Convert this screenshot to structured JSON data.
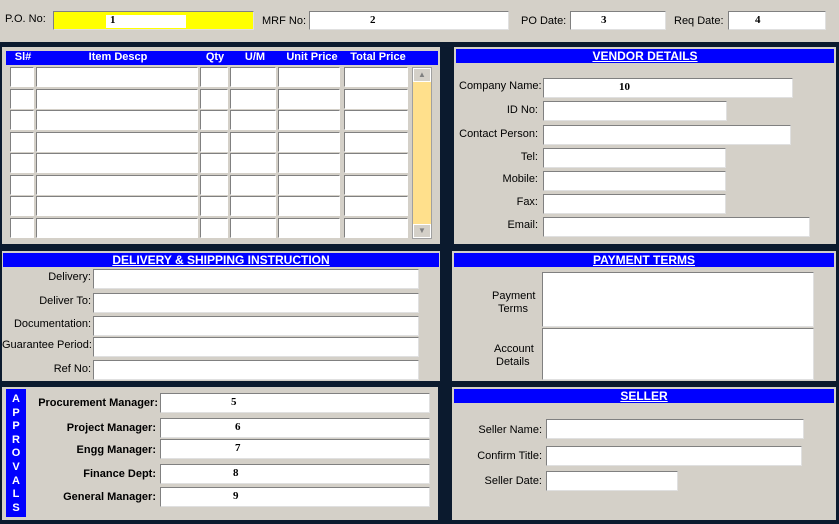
{
  "top": {
    "po_no_label": "P.O. No:",
    "po_no_value": "1",
    "mrf_no_label": "MRF No:",
    "mrf_no_value": "2",
    "po_date_label": "PO Date:",
    "po_date_value": "3",
    "req_date_label": "Req Date:",
    "req_date_value": "4"
  },
  "items": {
    "columns": [
      "Sl#",
      "Item Descp",
      "Qty",
      "U/M",
      "Unit Price",
      "Total Price"
    ],
    "row_count": 8
  },
  "vendor": {
    "title": "VENDOR DETAILS",
    "company_label": "Company Name:",
    "company_value": "10",
    "id_label": "ID No:",
    "contact_label": "Contact Person:",
    "tel_label": "Tel:",
    "mobile_label": "Mobile:",
    "fax_label": "Fax:",
    "email_label": "Email:"
  },
  "delivery": {
    "title": "DELIVERY & SHIPPING INSTRUCTION",
    "delivery_label": "Delivery:",
    "deliver_to_label": "Deliver To:",
    "documentation_label": "Documentation:",
    "guarantee_label": "Guarantee Period:",
    "ref_label": "Ref No:"
  },
  "payment": {
    "title": "PAYMENT TERMS",
    "terms_label_1": "Payment",
    "terms_label_2": "Terms",
    "account_label_1": "Account",
    "account_label_2": "Details"
  },
  "approvals": {
    "side_letters": [
      "A",
      "P",
      "P",
      "R",
      "O",
      "V",
      "A",
      "L",
      "S"
    ],
    "procurement_label": "Procurement Manager:",
    "procurement_value": "5",
    "project_label": "Project Manager:",
    "project_value": "6",
    "engg_label": "Engg Manager:",
    "engg_value": "7",
    "finance_label": "Finance Dept:",
    "finance_value": "8",
    "general_label": "General Manager:",
    "general_value": "9"
  },
  "seller": {
    "title": "SELLER",
    "name_label": "Seller Name:",
    "confirm_label": "Confirm Title:",
    "date_label": "Seller Date:"
  },
  "colors": {
    "header_blue": "#0000ff",
    "panel_grey": "#d4d0c8",
    "highlight_yellow": "#ffff00",
    "scroll_yellow": "#ffe08c"
  }
}
